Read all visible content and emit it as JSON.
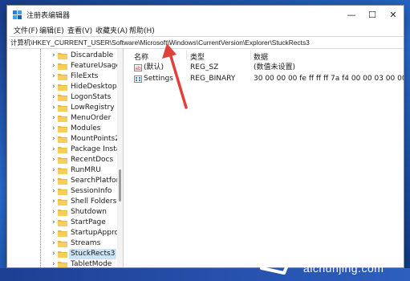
{
  "window": {
    "title": "注册表编辑器",
    "controls": {
      "minimize": "—",
      "maximize": "☐",
      "close": "✕"
    }
  },
  "menu": [
    "文件(F)",
    "编辑(E)",
    "查看(V)",
    "收藏夹(A)",
    "帮助(H)"
  ],
  "address": "计算机\\HKEY_CURRENT_USER\\Software\\Microsoft\\Windows\\CurrentVersion\\Explorer\\StuckRects3",
  "tree": {
    "items": [
      {
        "label": "Discardable",
        "selected": false
      },
      {
        "label": "FeatureUsage",
        "selected": false
      },
      {
        "label": "FileExts",
        "selected": false
      },
      {
        "label": "HideDesktopIcc",
        "selected": false
      },
      {
        "label": "LogonStats",
        "selected": false
      },
      {
        "label": "LowRegistry",
        "selected": false
      },
      {
        "label": "MenuOrder",
        "selected": false
      },
      {
        "label": "Modules",
        "selected": false
      },
      {
        "label": "MountPoints2",
        "selected": false
      },
      {
        "label": "Package Installa",
        "selected": false
      },
      {
        "label": "RecentDocs",
        "selected": false
      },
      {
        "label": "RunMRU",
        "selected": false
      },
      {
        "label": "SearchPlatform",
        "selected": false
      },
      {
        "label": "SessionInfo",
        "selected": false
      },
      {
        "label": "Shell Folders",
        "selected": false
      },
      {
        "label": "Shutdown",
        "selected": false
      },
      {
        "label": "StartPage",
        "selected": false
      },
      {
        "label": "StartupApprove",
        "selected": false
      },
      {
        "label": "Streams",
        "selected": false
      },
      {
        "label": "StuckRects3",
        "selected": true
      },
      {
        "label": "TabletMode",
        "selected": false
      }
    ]
  },
  "values": {
    "headers": {
      "name": "名称",
      "type": "类型",
      "data": "数据"
    },
    "rows": [
      {
        "name": "(默认)",
        "type": "REG_SZ",
        "data": "(数值未设置)",
        "icon": "string-value-icon"
      },
      {
        "name": "Settings",
        "type": "REG_BINARY",
        "data": "30 00 00 00 fe ff ff ff 7a f4 00 00 03 00 00 00 ...",
        "icon": "binary-value-icon"
      }
    ]
  },
  "watermark": {
    "line1": "爱纯净",
    "line2": "aichunjing.com"
  },
  "colors": {
    "selection": "#cce4f7",
    "folder": "#e8b93a",
    "arrow": "#e0403a",
    "accent": "#0078d4"
  }
}
